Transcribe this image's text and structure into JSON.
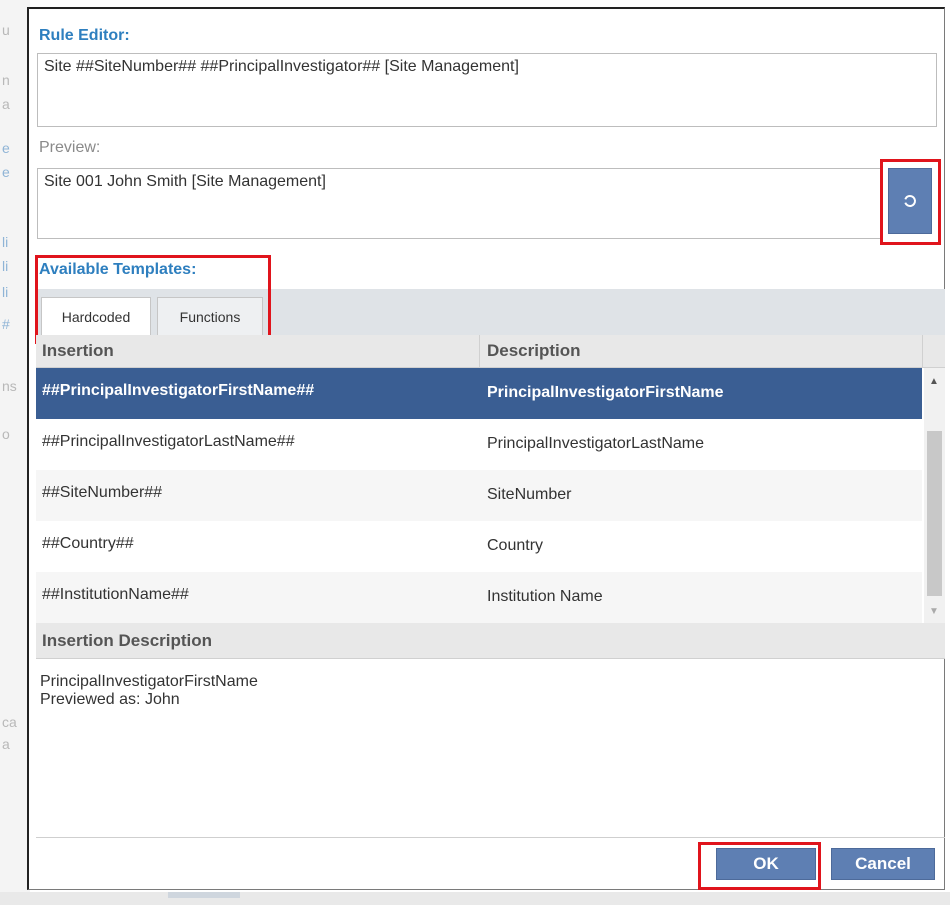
{
  "background": {
    "fragments": [
      "u",
      "n",
      "a",
      "e",
      "e",
      "li",
      "li",
      "li",
      "#",
      "ns",
      "o",
      "ca",
      "a"
    ]
  },
  "rule_editor": {
    "label": "Rule Editor:",
    "value": "Site ##SiteNumber## ##PrincipalInvestigator## [Site Management]"
  },
  "preview": {
    "label": "Preview:",
    "value": "Site 001 John Smith [Site Management]",
    "refresh_icon": "refresh-icon"
  },
  "templates": {
    "label": "Available Templates:",
    "tabs": [
      {
        "label": "Hardcoded",
        "active": true
      },
      {
        "label": "Functions",
        "active": false
      }
    ]
  },
  "grid": {
    "columns": [
      "Insertion",
      "Description"
    ],
    "rows": [
      {
        "insertion": "##PrincipalInvestigatorFirstName##",
        "description": "PrincipalInvestigatorFirstName",
        "selected": true
      },
      {
        "insertion": "##PrincipalInvestigatorLastName##",
        "description": "PrincipalInvestigatorLastName",
        "selected": false
      },
      {
        "insertion": "##SiteNumber##",
        "description": "SiteNumber",
        "selected": false
      },
      {
        "insertion": "##Country##",
        "description": "Country",
        "selected": false
      },
      {
        "insertion": "##InstitutionName##",
        "description": "Institution Name",
        "selected": false
      }
    ]
  },
  "insertion_description": {
    "header": "Insertion Description",
    "line1": "PrincipalInvestigatorFirstName",
    "line2": "Previewed as: John"
  },
  "footer": {
    "ok_label": "OK",
    "cancel_label": "Cancel"
  },
  "colors": {
    "accent": "#2e7fbf",
    "selected_row": "#3a5e93",
    "button": "#5e7fb3",
    "highlight": "#e0141c"
  }
}
